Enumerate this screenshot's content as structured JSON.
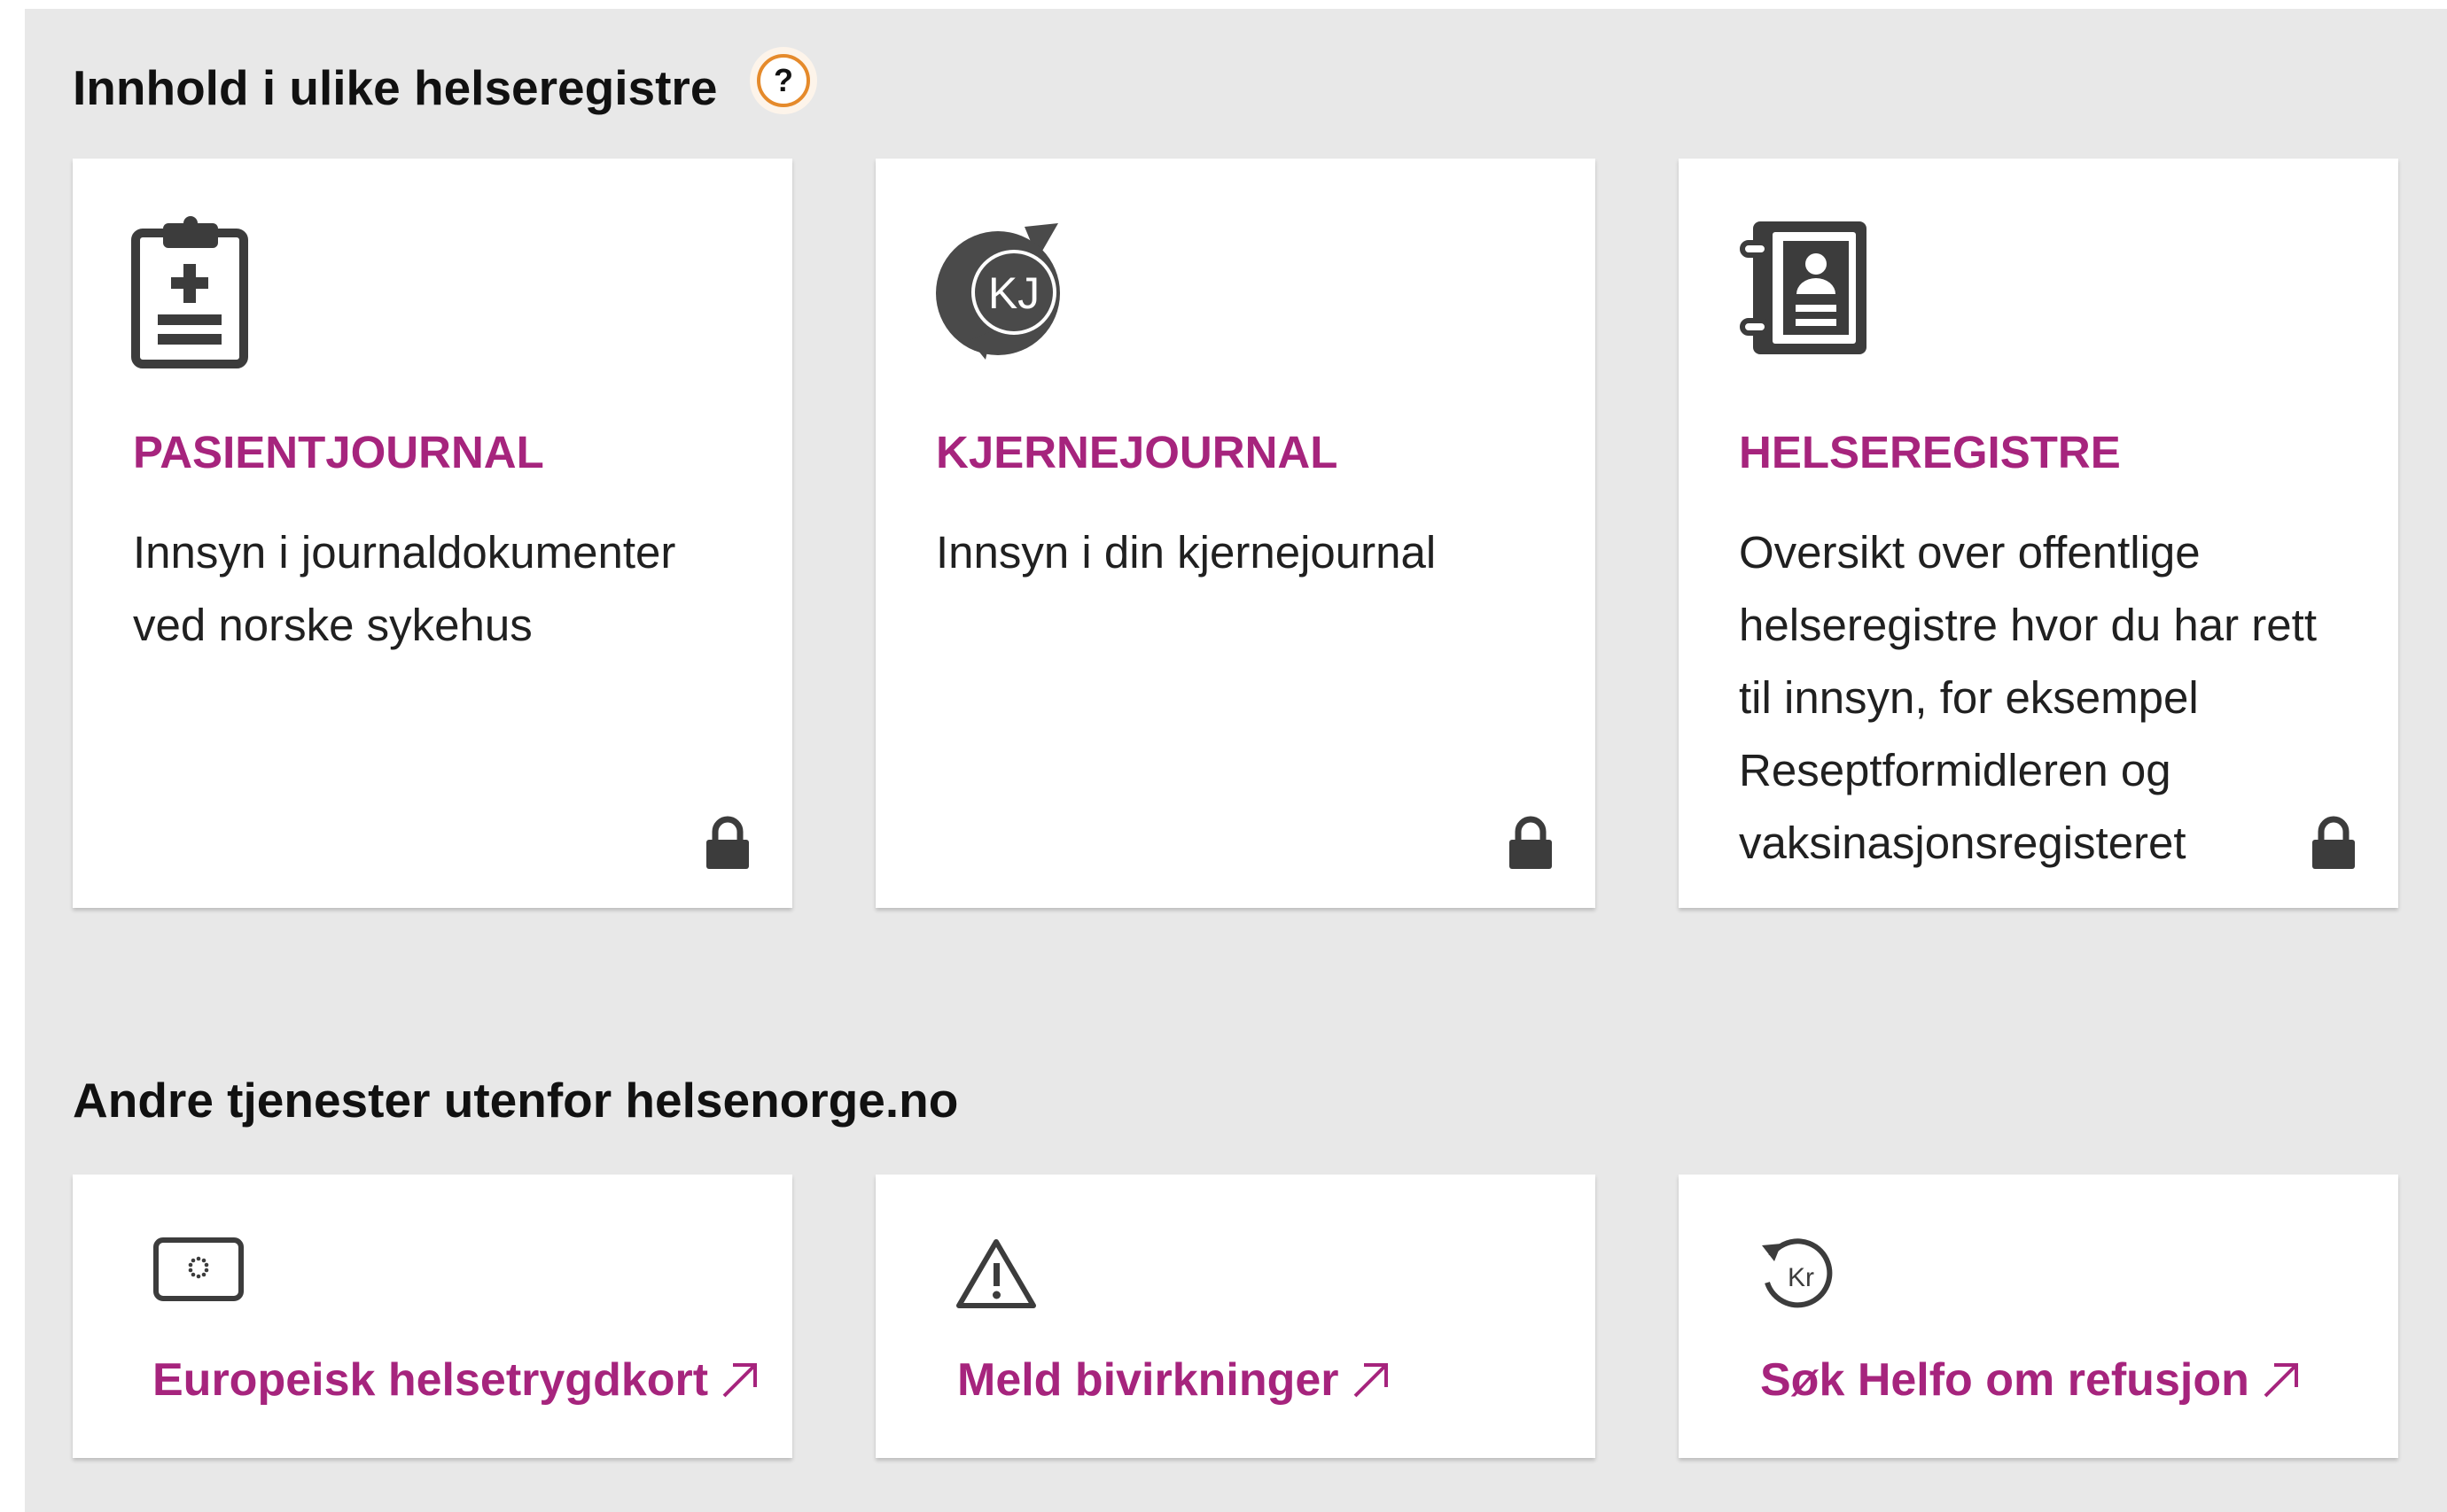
{
  "registries": {
    "heading": "Innhold i ulike helseregistre",
    "help_label": "?",
    "cards": [
      {
        "icon": "clipboard-medical-icon",
        "title": "PASIENTJOURNAL",
        "description": "Innsyn i journaldokumenter ved norske sykehus",
        "locked": true
      },
      {
        "icon": "kjernejournal-logo-icon",
        "logo_text": "KJ",
        "title": "KJERNEJOURNAL",
        "description": "Innsyn i din kjernejournal",
        "locked": true
      },
      {
        "icon": "contact-book-icon",
        "title": "HELSEREGISTRE",
        "description": "Oversikt over offentlige helseregistre hvor du har rett til innsyn, for eksempel Reseptformidleren og vaksinasjonsregisteret",
        "locked": true
      }
    ]
  },
  "other_services": {
    "heading": "Andre tjenester utenfor helsenorge.no",
    "links": [
      {
        "icon": "eu-health-card-icon",
        "label": "Europeisk helsetrygdkort",
        "external": true
      },
      {
        "icon": "warning-triangle-icon",
        "label": "Meld bivirkninger",
        "external": true
      },
      {
        "icon": "refund-kr-icon",
        "icon_text": "Kr",
        "label": "Søk Helfo om refusjon",
        "external": true
      }
    ]
  },
  "colors": {
    "accent": "#a6247d",
    "panel_bg": "#e8e8e8",
    "help_ring": "#e58a2b",
    "icon": "#3c3c3c"
  }
}
